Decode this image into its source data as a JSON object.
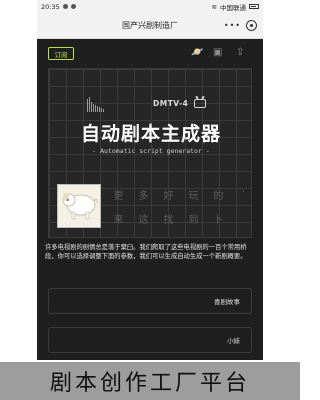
{
  "status_bar": {
    "left_text": "20:35",
    "right_text": "中国联通"
  },
  "header": {
    "title": "国产兴剧制造厂",
    "menu_icon": "more-dots-icon",
    "record_icon": "target-icon"
  },
  "toolbar": {
    "subscribe_label": "订阅",
    "icons": [
      "planet-icon",
      "save-icon",
      "share-icon"
    ]
  },
  "banner": {
    "brand": "DMTV-4",
    "title": "自动剧本主成器",
    "subtitle": "- Automatic script generator -",
    "chars_row1": [
      "更",
      "多",
      "好",
      "玩",
      "的",
      "·"
    ],
    "chars_row2": [
      "来",
      "这",
      "找",
      "到",
      "卜",
      ""
    ]
  },
  "description": "许多电视剧的剧情总是落于窠臼。我们爬取了这些电视剧的一百个常用桥段，你可以选择调整下面的参数，我们可以生成自动生成一个新剧概要。",
  "selects": [
    {
      "value": "喜剧故事"
    },
    {
      "value": "小妹"
    }
  ],
  "caption": "剧本创作工厂平台",
  "colors": {
    "accent": "#b7e34d",
    "background": "#1f1f1f"
  }
}
